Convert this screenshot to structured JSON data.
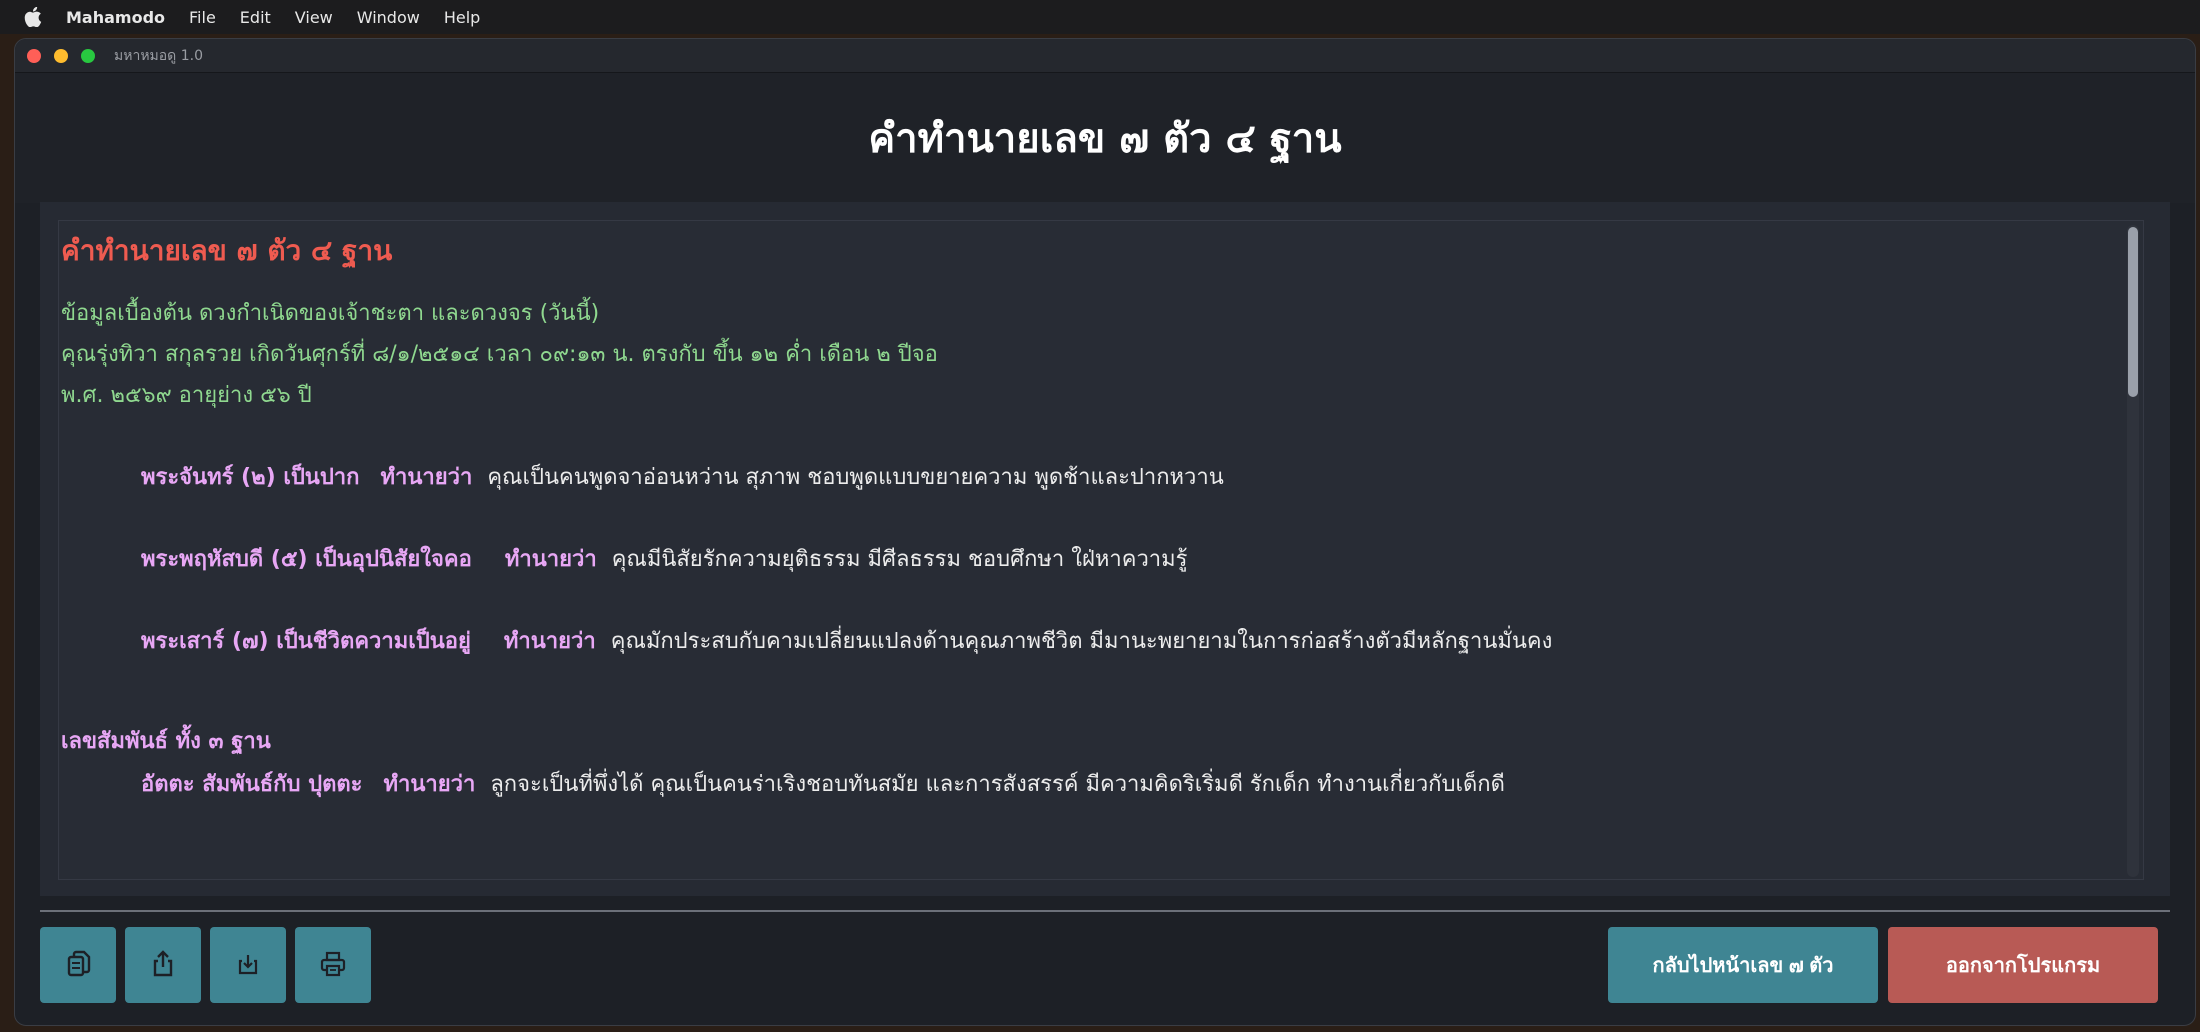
{
  "menubar": {
    "app_name": "Mahamodo",
    "items": [
      "File",
      "Edit",
      "View",
      "Window",
      "Help"
    ]
  },
  "window": {
    "title": "มหาหมอดู 1.0"
  },
  "header": {
    "title": "คำทำนายเลข ๗ ตัว ๔ ฐาน"
  },
  "report": {
    "title": "คำทำนายเลข ๗ ตัว ๔ ฐาน",
    "info_lines": [
      "ข้อมูลเบื้องต้น ดวงกำเนิดของเจ้าชะตา และดวงจร (วันนี้)",
      "คุณรุ่งทิวา สกุลรวย เกิดวันศุกร์ที่ ๘/๑/๒๕๑๔ เวลา ๐๙:๑๓ น. ตรงกับ ขึ้น ๑๒ ค่ำ เดือน ๒ ปีจอ",
      "พ.ศ. ๒๕๖๙ อายุย่าง ๕๖ ปี"
    ],
    "predictions": [
      {
        "planet": "พระจันทร์ (๒) เป็นปาก",
        "label": "ทำนายว่า",
        "text": "คุณเป็นคนพูดจาอ่อนหว่าน  สุภาพ  ชอบพูดแบบขยายความ พูดช้าและปากหวาน"
      },
      {
        "planet": "พระพฤหัสบดี (๕) เป็นอุปนิสัยใจคอ",
        "label": "ทำนายว่า",
        "text": "คุณมีนิสัยรักความยุติธรรม  มีศีลธรรม  ชอบศึกษา  ใฝ่หาความรู้"
      },
      {
        "planet": "พระเสาร์ (๗) เป็นชีวิตความเป็นอยู่",
        "label": "ทำนายว่า",
        "text": "คุณมักประสบกับคามเปลี่ยนแปลงด้านคุณภาพชีวิต  มีมานะพยายามในการก่อสร้างตัวมีหลักฐานมั่นคง"
      }
    ],
    "relation_heading": "เลขสัมพันธ์ ทั้ง ๓ ฐาน",
    "relations": [
      {
        "pair": "อัตตะ สัมพันธ์กับ ปุตตะ",
        "label": "ทำนายว่า",
        "text": "ลูกจะเป็นที่พึ่งได้ คุณเป็นคนร่าเริงชอบทันสมัย และการสังสรรค์ มีความคิดริเริ่มดี รักเด็ก ทำงานเกี่ยวกับเด็กดี"
      }
    ]
  },
  "footer": {
    "icons": [
      "copy-icon",
      "share-icon",
      "download-icon",
      "print-icon"
    ],
    "nav_label": "กลับไปหน้าเลข ๗ ตัว",
    "exit_label": "ออกจากโปรแกรม"
  },
  "colors": {
    "teal": "#3f8593",
    "red_button": "#b85a55",
    "title_red": "#ef5b50",
    "info_green": "#8fd88f",
    "pink": "#e8a7f5"
  }
}
